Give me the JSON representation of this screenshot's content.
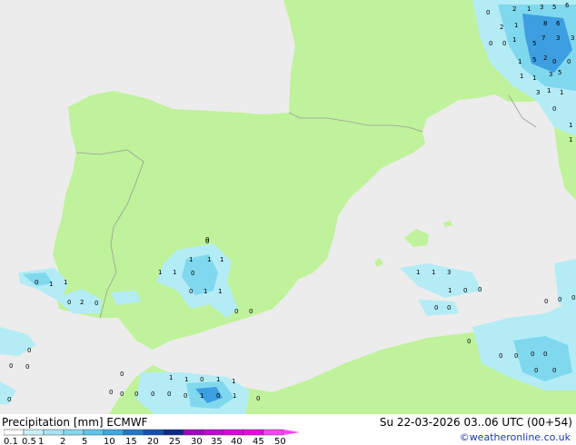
{
  "header": {
    "title": "Precipitation [mm] ECMWF",
    "valid_time": "Su 22-03-2026 03..06 UTC (00+54)",
    "credit": "©weatheronline.co.uk"
  },
  "legend": {
    "ticks": [
      "0.1",
      "0.5",
      "1",
      "2",
      "5",
      "10",
      "15",
      "20",
      "25",
      "30",
      "35",
      "40",
      "45",
      "50"
    ],
    "colors": [
      "#ffffff",
      "#c8f0f8",
      "#a6e4f4",
      "#84d8f0",
      "#5ac6ec",
      "#3aa8e4",
      "#1e78cc",
      "#1450b4",
      "#0c2a8c",
      "#a000c8",
      "#c400d8",
      "#dc00e0",
      "#f000e8",
      "#ff40ff"
    ]
  },
  "map": {
    "colors": {
      "sea": "#ececec",
      "land": "#bff29a",
      "border": "#9b9b9b",
      "rain_light": "#b4ecf6",
      "rain_medium": "#7fd8ee",
      "rain_heavy": "#3d9ee0"
    },
    "point_values": [
      {
        "v": "2"
      },
      {
        "v": "1"
      },
      {
        "v": "3"
      },
      {
        "v": "0"
      },
      {
        "v": "5"
      },
      {
        "v": "6"
      },
      {
        "v": "8"
      },
      {
        "v": "6"
      },
      {
        "v": "1"
      },
      {
        "v": "7"
      },
      {
        "v": "3"
      },
      {
        "v": "2"
      },
      {
        "v": "1"
      },
      {
        "v": "3"
      },
      {
        "v": "0"
      },
      {
        "v": "0"
      },
      {
        "v": "1"
      },
      {
        "v": "5"
      },
      {
        "v": "2"
      },
      {
        "v": "0"
      },
      {
        "v": "0"
      },
      {
        "v": "5"
      },
      {
        "v": "3"
      },
      {
        "v": "5"
      },
      {
        "v": "1"
      },
      {
        "v": "1"
      },
      {
        "v": "3"
      },
      {
        "v": "1"
      },
      {
        "v": "1"
      },
      {
        "v": "0"
      },
      {
        "v": "1"
      },
      {
        "v": "1"
      },
      {
        "v": "0"
      },
      {
        "v": "1"
      },
      {
        "v": "1"
      },
      {
        "v": "1"
      },
      {
        "v": "1"
      },
      {
        "v": "1"
      },
      {
        "v": "0"
      },
      {
        "v": "1"
      },
      {
        "v": "1"
      },
      {
        "v": "0"
      },
      {
        "v": "0"
      },
      {
        "v": "2"
      },
      {
        "v": "0"
      },
      {
        "v": "0"
      },
      {
        "v": "0"
      },
      {
        "v": "1"
      },
      {
        "v": "1"
      },
      {
        "v": "0"
      },
      {
        "v": "1"
      },
      {
        "v": "1"
      },
      {
        "v": "3"
      },
      {
        "v": "1"
      },
      {
        "v": "0"
      },
      {
        "v": "0"
      },
      {
        "v": "0"
      },
      {
        "v": "0"
      },
      {
        "v": "0"
      },
      {
        "v": "0"
      },
      {
        "v": "0"
      },
      {
        "v": "0"
      },
      {
        "v": "0"
      },
      {
        "v": "0"
      },
      {
        "v": "0"
      },
      {
        "v": "0"
      },
      {
        "v": "0"
      },
      {
        "v": "0"
      },
      {
        "v": "0"
      },
      {
        "v": "1"
      },
      {
        "v": "1"
      },
      {
        "v": "0"
      },
      {
        "v": "1"
      },
      {
        "v": "1"
      },
      {
        "v": "0"
      },
      {
        "v": "0"
      },
      {
        "v": "0"
      },
      {
        "v": "0"
      },
      {
        "v": "1"
      },
      {
        "v": "0"
      },
      {
        "v": "1"
      },
      {
        "v": "0"
      },
      {
        "v": "0"
      },
      {
        "v": "0"
      },
      {
        "v": "0"
      },
      {
        "v": "0"
      },
      {
        "v": "0"
      },
      {
        "v": "0"
      },
      {
        "v": "0"
      }
    ]
  }
}
